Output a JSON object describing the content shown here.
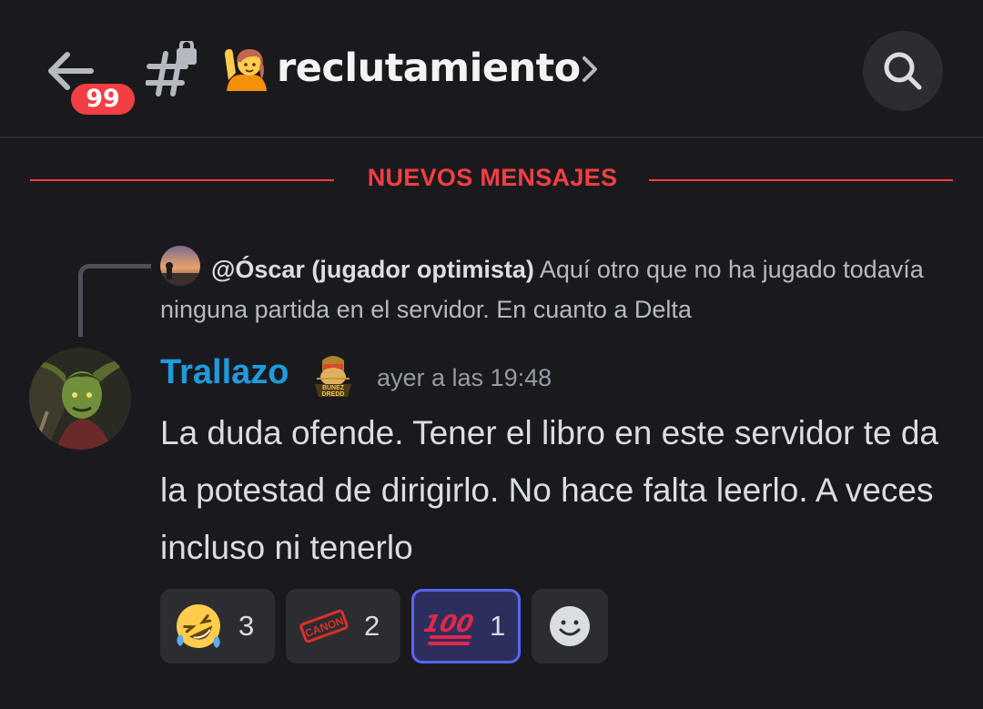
{
  "header": {
    "unread_count": "99",
    "channel_emoji": "raising-hand-emoji",
    "channel_name": "reclutamiento",
    "channel_icon": "locked-hash-icon"
  },
  "divider": {
    "label": "NUEVOS MENSAJES",
    "color": "#f23f43"
  },
  "reply": {
    "author": "@Óscar (jugador optimista)",
    "preview": "Aquí otro que no ha jugado todavía ninguna partida en el servidor.  En cuanto a Delta"
  },
  "message": {
    "author": "Trallazo",
    "author_color": "#1e9bdc",
    "role_icon": "bunez-dredd-role-icon",
    "timestamp": "ayer a las 19:48",
    "body": "La duda ofende. Tener el libro en este servidor te da la potestad de dirigirlo. No hace falta leerlo. A veces incluso ni tenerlo"
  },
  "reactions": [
    {
      "emoji": "rofl-emoji",
      "count": "3",
      "active": false
    },
    {
      "emoji": "canon-stamp-emoji",
      "count": "2",
      "active": false
    },
    {
      "emoji": "hundred-points-emoji",
      "count": "1",
      "active": true
    }
  ],
  "colors": {
    "background": "#1a1a1e",
    "pill": "#2b2d31",
    "accent": "#5865f2"
  }
}
